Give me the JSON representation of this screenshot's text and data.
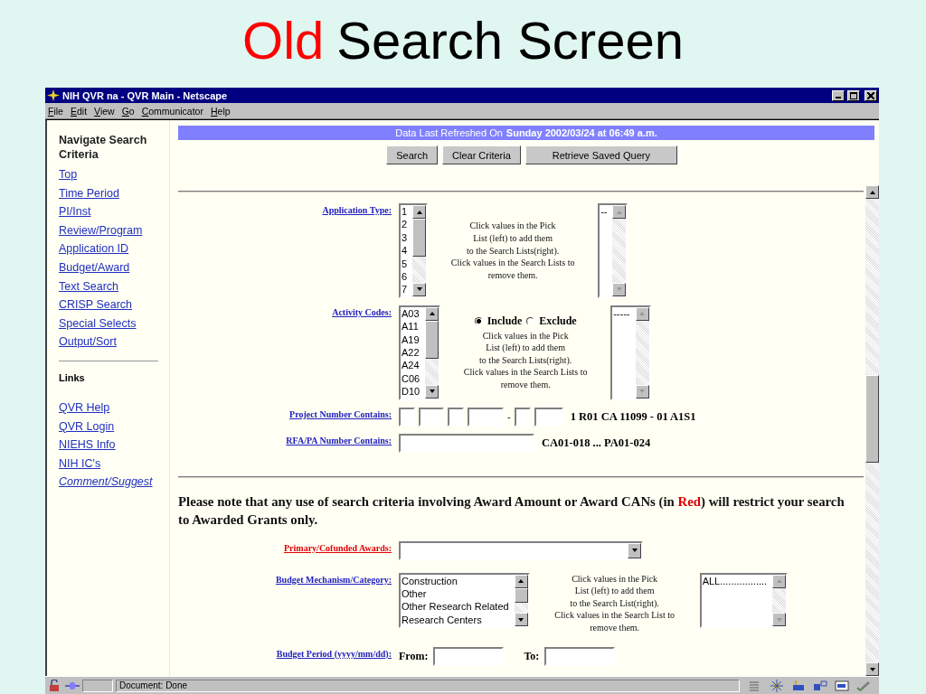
{
  "slide": {
    "title_highlight": "Old",
    "title": "Search Screen"
  },
  "window": {
    "title": "NIH QVR na - QVR Main - Netscape"
  },
  "menu": [
    "File",
    "Edit",
    "View",
    "Go",
    "Communicator",
    "Help"
  ],
  "sidebar": {
    "heading": "Navigate Search Criteria",
    "nav_links": [
      "Top",
      "Time Period",
      "PI/Inst",
      "Review/Program",
      "Application ID",
      "Budget/Award",
      "Text Search",
      "CRISP Search",
      "Special Selects",
      "Output/Sort"
    ],
    "links_heading": "Links",
    "links": [
      {
        "label": "QVR Help",
        "italic": false
      },
      {
        "label": "QVR Login",
        "italic": false
      },
      {
        "label": "NIEHS Info",
        "italic": false
      },
      {
        "label": "NIH IC's",
        "italic": false
      },
      {
        "label": "Comment/Suggest",
        "italic": true
      }
    ]
  },
  "header": {
    "refresh_label": "Data Last Refreshed On",
    "refresh_date": "Sunday 2002/03/24 at 06:49 a.m.",
    "buttons": [
      "Search",
      "Clear Criteria",
      "Retrieve Saved Query"
    ]
  },
  "criteria": [
    {
      "kind": "picklist",
      "label": "Application Type:",
      "restricted": false,
      "pick_items": [
        "1",
        "2",
        "3",
        "4",
        "5",
        "6",
        "7"
      ],
      "help": "Click values in the Pick\nList (left) to add them\nto the Search Lists(right).\nClick values in the Search Lists to\nremove them.",
      "search_items": [
        "--"
      ]
    },
    {
      "kind": "picklist",
      "label": "Activity Codes:",
      "restricted": false,
      "pick_items": [
        "A03",
        "A11",
        "A19",
        "A22",
        "A24",
        "C06",
        "D10"
      ],
      "options": [
        {
          "label": "Include",
          "selected": true
        },
        {
          "label": "Exclude",
          "selected": false
        }
      ],
      "help": "Click values in the Pick\nList (left) to add them\nto the Search Lists(right).\nClick values in the Search Lists to\nremove them.",
      "search_items": [
        "-----"
      ]
    },
    {
      "kind": "project",
      "label": "Project Number Contains:",
      "restricted": false,
      "separator": "-",
      "example": "1 R01 CA 11099 - 01 A1S1"
    },
    {
      "kind": "text",
      "label": "RFA/PA Number Contains:",
      "restricted": false,
      "example": "CA01-018 ... PA01-024"
    }
  ],
  "note": {
    "before": "Please note that any use of search criteria involving Award Amount or Award CANs (in ",
    "highlight": "Red",
    "after": ") will restrict your search to Awarded Grants only."
  },
  "award_criteria": [
    {
      "kind": "select",
      "label": "Primary/Cofunded Awards:",
      "restricted": true
    },
    {
      "kind": "picklist",
      "label": "Budget Mechanism/Category:",
      "restricted": false,
      "pick_items": [
        "Construction",
        "Other",
        "Other Research Related",
        "Research Centers"
      ],
      "help": "Click values in the Pick\nList (left) to add them\nto the Search List(right).\nClick values in the Search List to\nremove them.",
      "search_items": [
        "ALL................."
      ]
    },
    {
      "kind": "period",
      "label": "Budget Period (yyyy/mm/dd):",
      "restricted": false,
      "from_label": "From:",
      "to_label": "To:"
    }
  ],
  "status_bar": {
    "text": "Document: Done"
  }
}
